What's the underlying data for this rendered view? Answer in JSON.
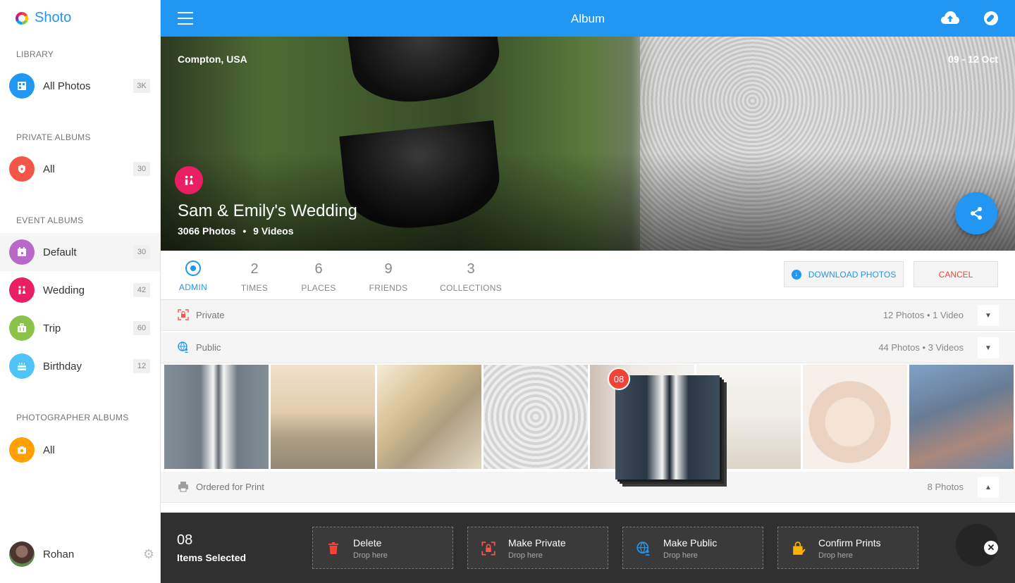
{
  "app": {
    "name": "Shoto",
    "title": "Album"
  },
  "sidebar": {
    "sections": [
      {
        "title": "LIBRARY"
      },
      {
        "title": "PRIVATE ALBUMS"
      },
      {
        "title": "EVENT ALBUMS"
      },
      {
        "title": "PHOTOGRAPHER ALBUMS"
      }
    ],
    "items": [
      {
        "label": "All Photos",
        "count": "3K",
        "icon": "photos-icon",
        "color": "#2196f3"
      },
      {
        "label": "All",
        "count": "30",
        "icon": "lock-shield-icon",
        "color": "#f4574a"
      },
      {
        "label": "Default",
        "count": "30",
        "icon": "calendar-icon",
        "color": "#ba68c8"
      },
      {
        "label": "Wedding",
        "count": "42",
        "icon": "couple-icon",
        "color": "#e91e63"
      },
      {
        "label": "Trip",
        "count": "60",
        "icon": "luggage-icon",
        "color": "#8bc34a"
      },
      {
        "label": "Birthday",
        "count": "12",
        "icon": "cake-icon",
        "color": "#4fc3f7"
      },
      {
        "label": "All",
        "count": "",
        "icon": "camera-icon",
        "color": "#ffa000"
      }
    ],
    "user": {
      "name": "Rohan"
    }
  },
  "album": {
    "location": "Compton, USA",
    "dates": "09 - 12 Oct",
    "title": "Sam & Emily's Wedding",
    "photos": "3066 Photos",
    "separator": "•",
    "videos": "9 Videos"
  },
  "tabs": [
    {
      "number": "",
      "label": "ADMIN",
      "active": true
    },
    {
      "number": "2",
      "label": "TIMES"
    },
    {
      "number": "6",
      "label": "PLACES"
    },
    {
      "number": "9",
      "label": "FRIENDS"
    },
    {
      "number": "3",
      "label": "COLLECTIONS"
    }
  ],
  "actions": {
    "download": "DOWNLOAD PHOTOS",
    "cancel": "CANCEL"
  },
  "groups": [
    {
      "label": "Private",
      "meta": "12 Photos • 1 Video"
    },
    {
      "label": "Public",
      "meta": "44 Photos • 3 Videos"
    },
    {
      "label": "Ordered for Print",
      "meta": "8 Photos"
    }
  ],
  "drag": {
    "count": "08"
  },
  "selection": {
    "count": "08",
    "label": "Items Selected",
    "drops": [
      {
        "title": "Delete",
        "sub": "Drop here",
        "color": "#f44336"
      },
      {
        "title": "Make Private",
        "sub": "Drop here",
        "color": "#f4574a"
      },
      {
        "title": "Make Public",
        "sub": "Drop here",
        "color": "#2196f3"
      },
      {
        "title": "Confirm Prints",
        "sub": "Drop here",
        "color": "#ffb300"
      }
    ]
  }
}
